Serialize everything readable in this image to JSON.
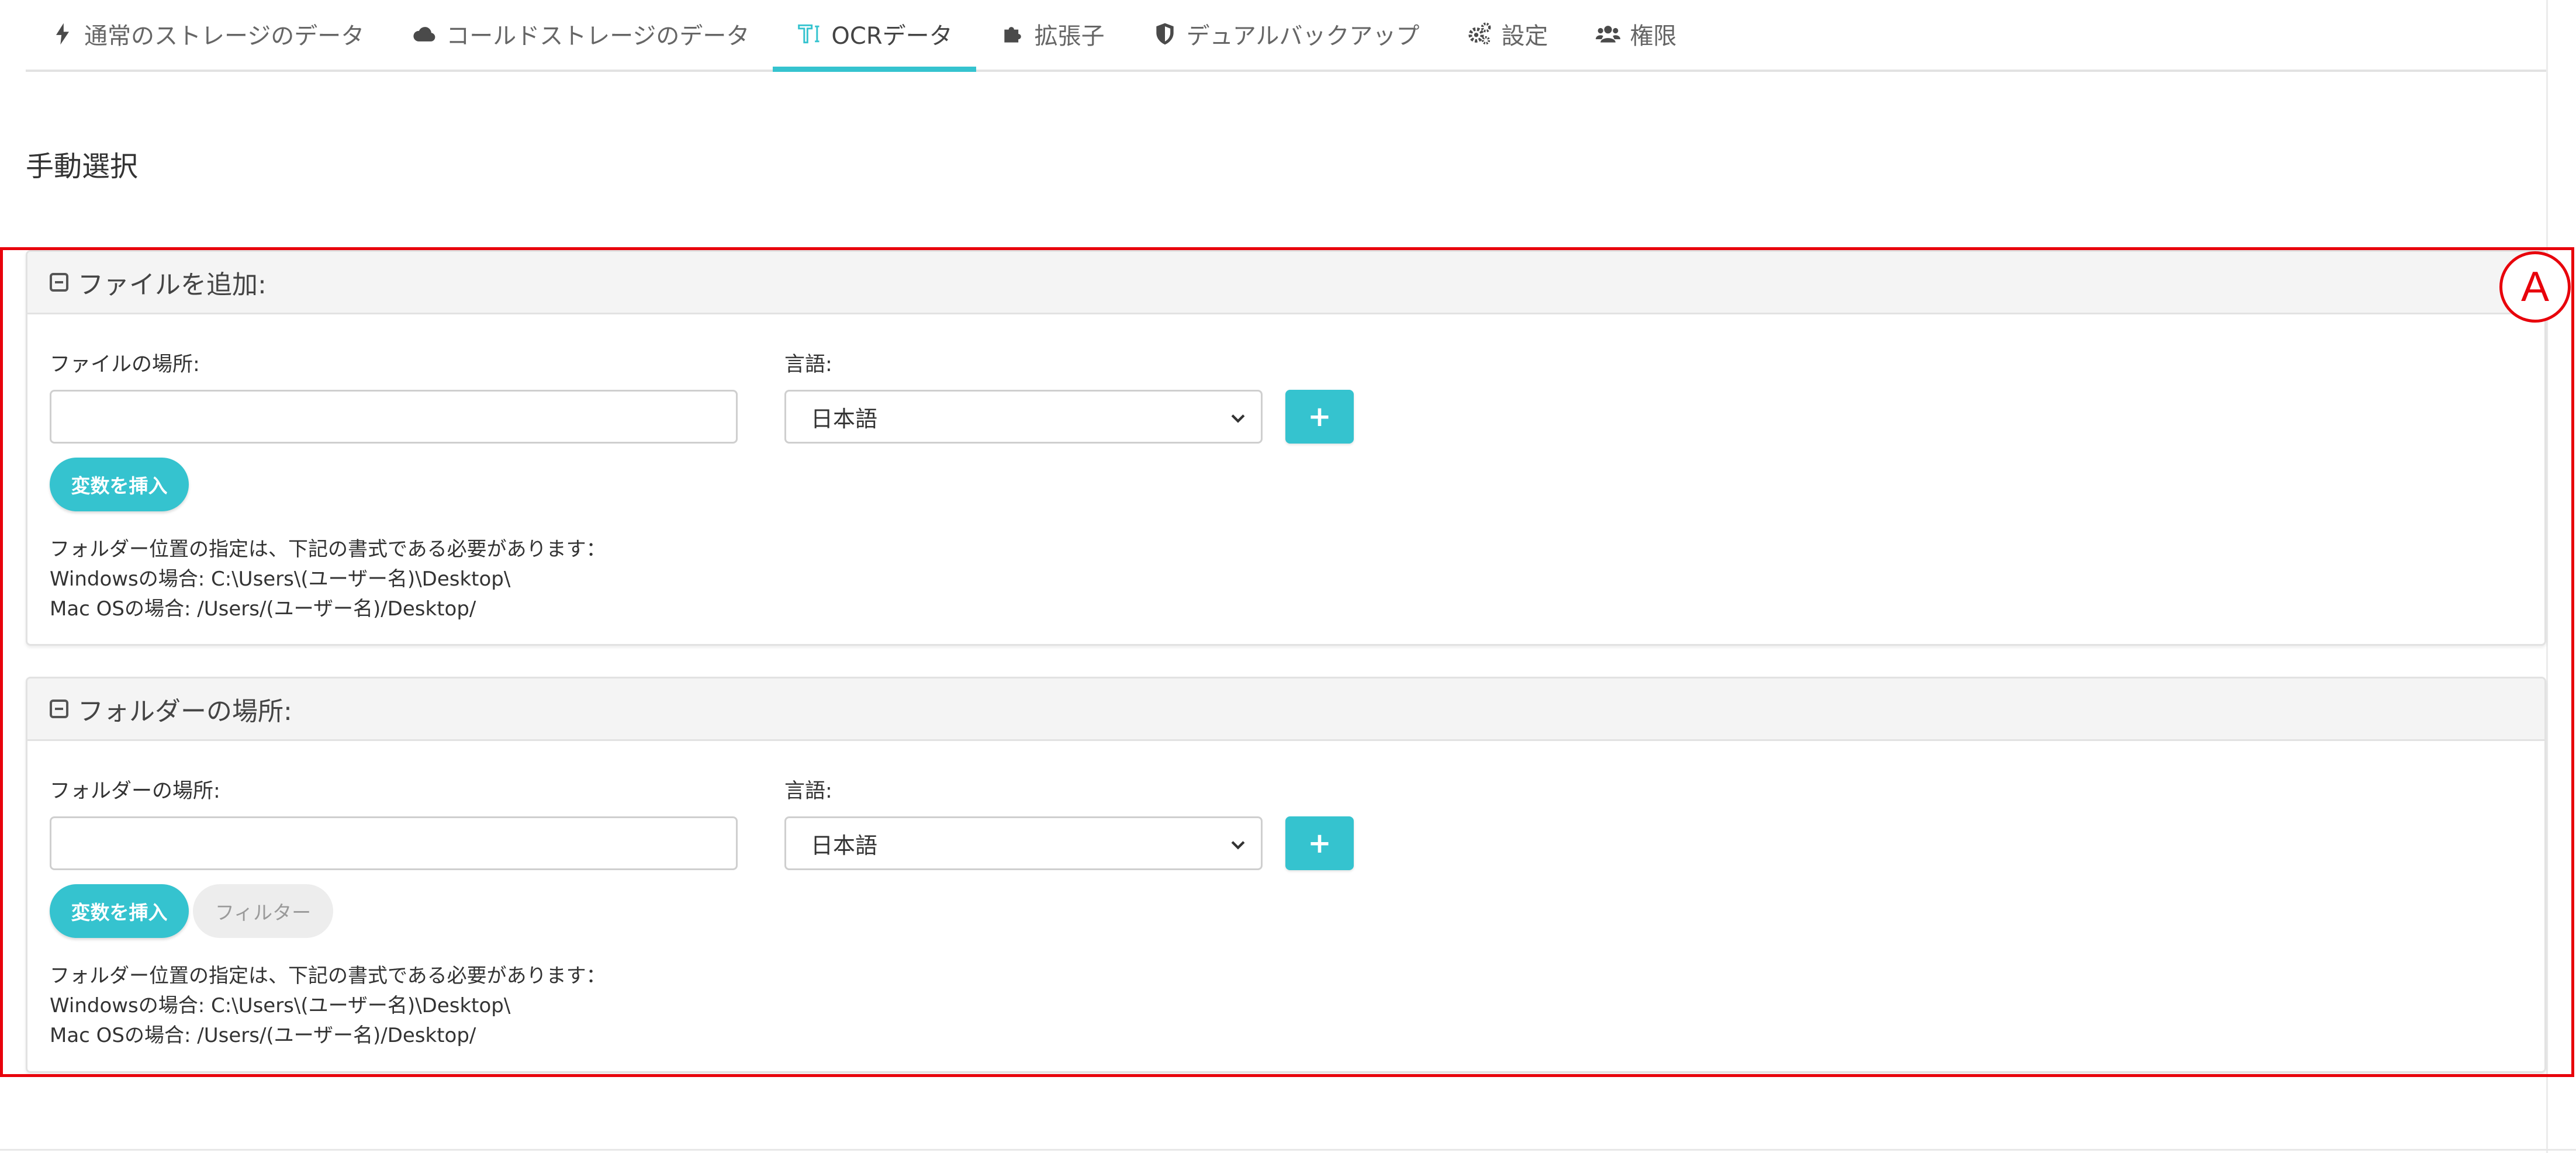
{
  "tabs": [
    {
      "label": "通常のストレージのデータ",
      "icon": "bolt-icon",
      "active": false
    },
    {
      "label": "コールドストレージのデータ",
      "icon": "cloud-icon",
      "active": false
    },
    {
      "label": "OCRデータ",
      "icon": "text-cursor-icon",
      "active": true
    },
    {
      "label": "拡張子",
      "icon": "puzzle-icon",
      "active": false
    },
    {
      "label": "デュアルバックアップ",
      "icon": "shield-icon",
      "active": false
    },
    {
      "label": "設定",
      "icon": "gears-icon",
      "active": false
    },
    {
      "label": "権限",
      "icon": "users-icon",
      "active": false
    }
  ],
  "page_title": "手動選択",
  "annotation": {
    "marker": "A",
    "color": "#e8000b"
  },
  "accent_color": "#35c3cf",
  "file_panel": {
    "title": "ファイルを追加:",
    "location_label": "ファイルの場所:",
    "location_value": "",
    "language_label": "言語:",
    "language_value": "日本語",
    "add_button": "+",
    "insert_variable_button": "変数を挿入",
    "note_lines": [
      "フォルダー位置の指定は、下記の書式である必要があります：",
      "Windowsの場合: C:\\Users\\(ユーザー名)\\Desktop\\",
      "Mac OSの場合: /Users/(ユーザー名)/Desktop/"
    ]
  },
  "folder_panel": {
    "title": "フォルダーの場所:",
    "location_label": "フォルダーの場所:",
    "location_value": "",
    "language_label": "言語:",
    "language_value": "日本語",
    "add_button": "+",
    "insert_variable_button": "変数を挿入",
    "filter_button": "フィルター",
    "note_lines": [
      "フォルダー位置の指定は、下記の書式である必要があります：",
      "Windowsの場合: C:\\Users\\(ユーザー名)\\Desktop\\",
      "Mac OSの場合: /Users/(ユーザー名)/Desktop/"
    ]
  }
}
